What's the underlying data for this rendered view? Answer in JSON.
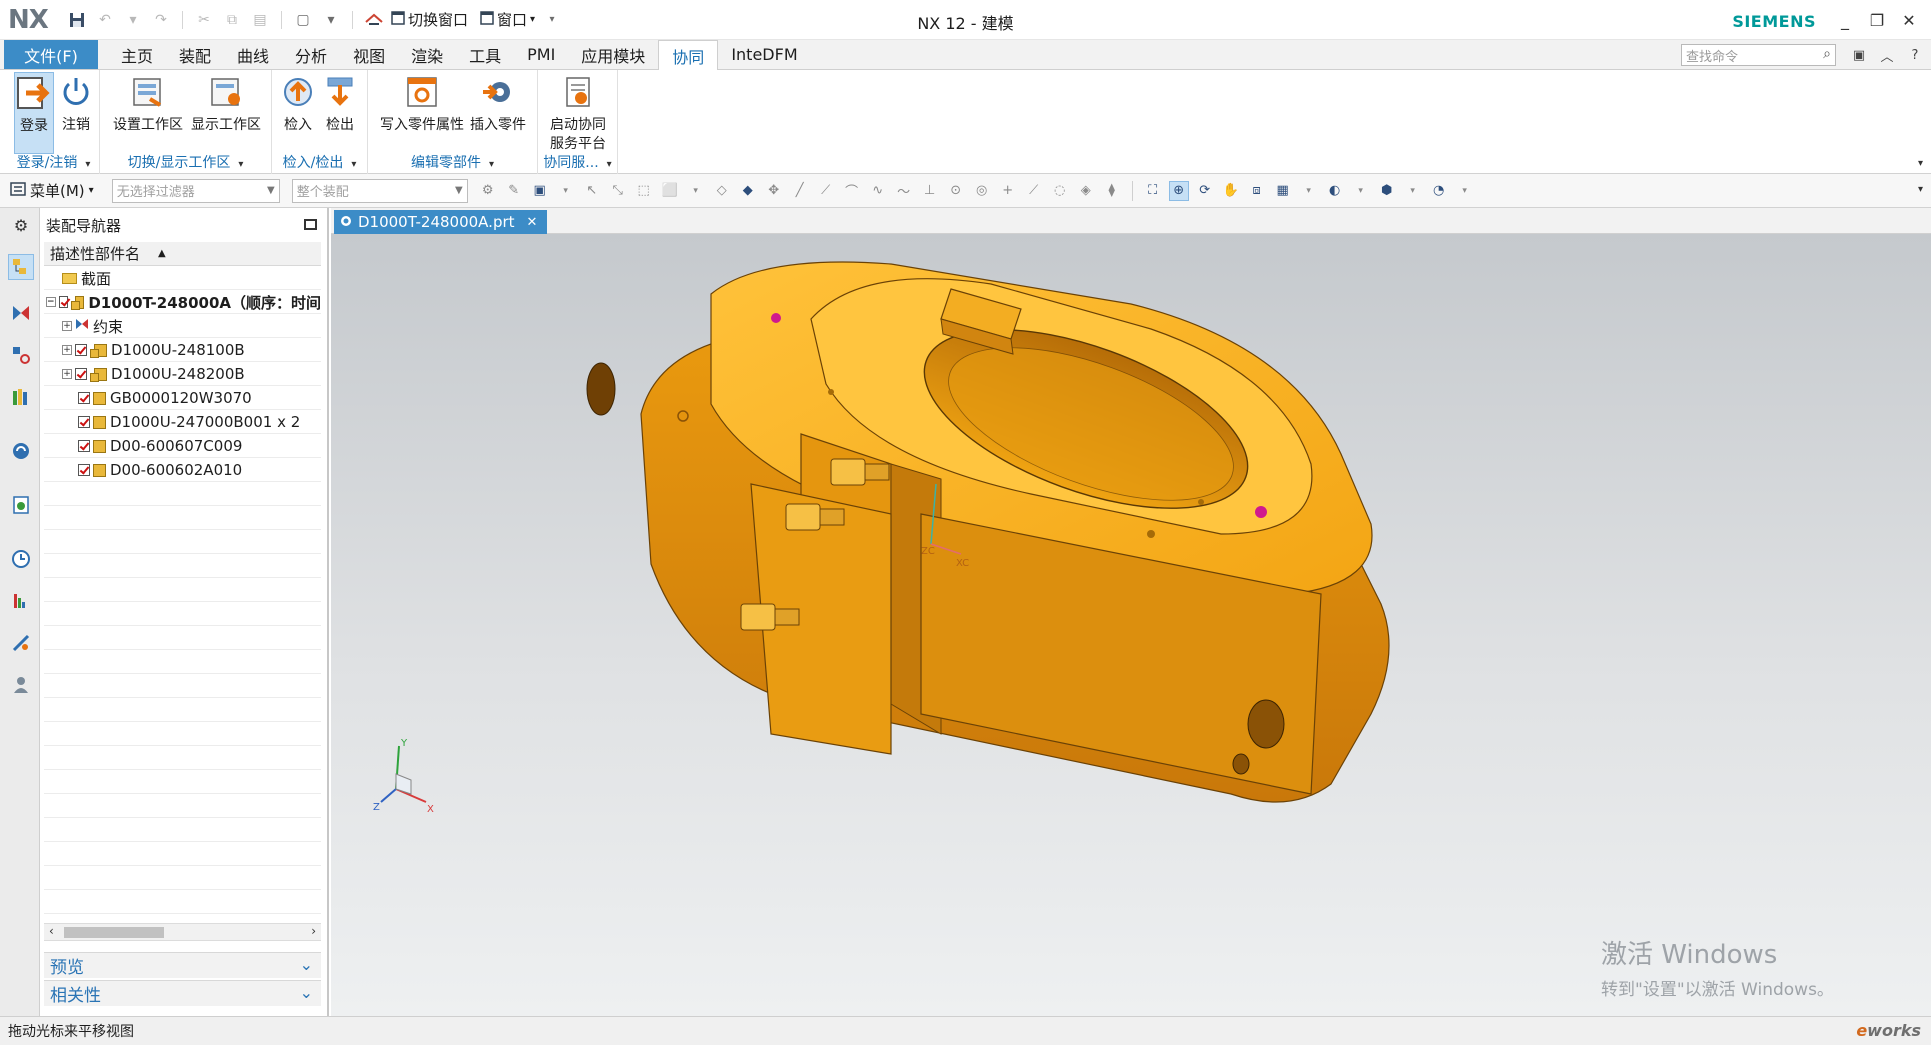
{
  "app": {
    "logo": "NX",
    "title": "NX 12 - 建模",
    "brand": "SIEMENS"
  },
  "quick_access": {
    "switch_window": "切换窗口",
    "window": "窗口"
  },
  "tabs": {
    "file": "文件(F)",
    "items": [
      "主页",
      "装配",
      "曲线",
      "分析",
      "视图",
      "渲染",
      "工具",
      "PMI",
      "应用模块",
      "协同",
      "InteDFM"
    ],
    "active": "协同"
  },
  "search": {
    "placeholder": "查找命令"
  },
  "ribbon": {
    "groups": [
      {
        "label": "登录/注销",
        "buttons": [
          "登录",
          "注销"
        ]
      },
      {
        "label": "切换/显示工作区",
        "buttons": [
          "设置工作区",
          "显示工作区"
        ]
      },
      {
        "label": "检入/检出",
        "buttons": [
          "检入",
          "检出"
        ]
      },
      {
        "label": "编辑零部件",
        "buttons": [
          "写入零件属性",
          "插入零件"
        ]
      },
      {
        "label": "协同服...",
        "buttons": [
          "启动协同\n服务平台"
        ]
      }
    ],
    "launch_line1": "启动协同",
    "launch_line2": "服务平台"
  },
  "toolbar": {
    "menu_label": "菜单(M)",
    "filter_placeholder": "无选择过滤器",
    "scope_placeholder": "整个装配"
  },
  "navigator": {
    "title": "装配导航器",
    "column_header": "描述性部件名",
    "rows": [
      {
        "label": "截面",
        "type": "folder"
      },
      {
        "label": "D1000T-248000A（顺序：时间",
        "type": "root"
      },
      {
        "label": "约束",
        "type": "constraints"
      },
      {
        "label": "D1000U-248100B",
        "type": "subassembly"
      },
      {
        "label": "D1000U-248200B",
        "type": "subassembly"
      },
      {
        "label": "GB0000120W3070",
        "type": "part"
      },
      {
        "label": "D1000U-247000B001 x 2",
        "type": "part"
      },
      {
        "label": "D00-600607C009",
        "type": "part"
      },
      {
        "label": "D00-600602A010",
        "type": "part"
      }
    ],
    "preview_panel": "预览",
    "dependency_panel": "相关性"
  },
  "document": {
    "tab_label": "D1000T-248000A.prt"
  },
  "viewport": {
    "triad_labels": [
      "Y",
      "Z",
      "X"
    ],
    "wcs_labels": [
      "ZC",
      "XC"
    ],
    "activation_watermark_line1": "激活 Windows",
    "activation_watermark_line2": "转到\"设置\"以激活 Windows。"
  },
  "status": {
    "message": "拖动光标来平移视图",
    "corner_brand": "works"
  },
  "colors": {
    "accent": "#3c8cc7",
    "siemens_teal": "#009999",
    "part_orange": "#f0a412"
  }
}
